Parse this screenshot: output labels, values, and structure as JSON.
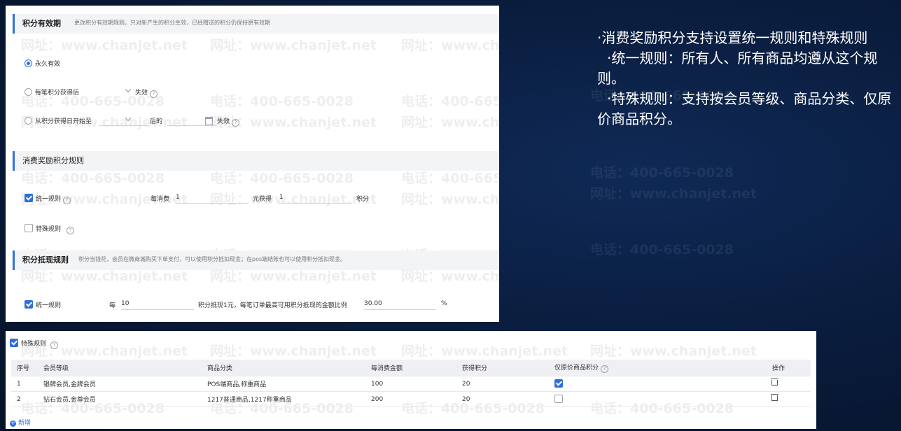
{
  "watermark": {
    "phone": "电话：400-665-0028",
    "site": "网址：www.chanjet.net"
  },
  "validity": {
    "title": "积分有效期",
    "desc": "更改积分有效期规则，只对新产生的积分生效，已经赠送的积分仍保持原有效期",
    "opt_forever": "永久有效",
    "opt_each_prefix": "每笔积分获得后",
    "opt_each_suffix": "失效",
    "opt_from_prefix": "从积分获得日开始至",
    "opt_from_mid": "后的",
    "opt_from_suffix": "失效"
  },
  "consume": {
    "title": "消费奖励积分规则",
    "unified_label": "统一规则",
    "per_spend_label": "每消费",
    "per_spend_value": "1",
    "earn_label": "元获得",
    "earn_value": "1",
    "unit": "积分",
    "special_label": "特殊规则"
  },
  "cash": {
    "title": "积分抵现规则",
    "desc": "积分当钱花，会员在微商城购买下单支付，可以使用积分抵扣现金；在pos端结账也可以使用积分抵扣现金。",
    "unified_label": "统一规则",
    "each_label": "每",
    "each_value": "10",
    "rate_text": "积分抵现1元，每笔订单最高可用积分抵现的金额比例",
    "ratio_value": "30.00",
    "percent": "%"
  },
  "special": {
    "label": "特殊规则",
    "columns": [
      "序号",
      "会员等级",
      "商品分类",
      "每消费金额",
      "获得积分",
      "仅原价商品积分",
      "操作"
    ],
    "rows": [
      {
        "no": "1",
        "level": "银牌会员,金牌会员",
        "category": "POS端商品,称重商品",
        "spend": "100",
        "points": "20",
        "original_only": true
      },
      {
        "no": "2",
        "level": "钻石会员,金尊会员",
        "category": "1217普通商品,1217称重商品",
        "spend": "200",
        "points": "20",
        "original_only": false
      }
    ],
    "add_label": "新增"
  },
  "caption": {
    "line1": "·消费奖励积分支持设置统一规则和特殊规则",
    "line2": "·统一规则：所有人、所有商品均遵从这个规则。",
    "line3": "·特殊规则：支持按会员等级、商品分类、仅原价商品积分。"
  }
}
